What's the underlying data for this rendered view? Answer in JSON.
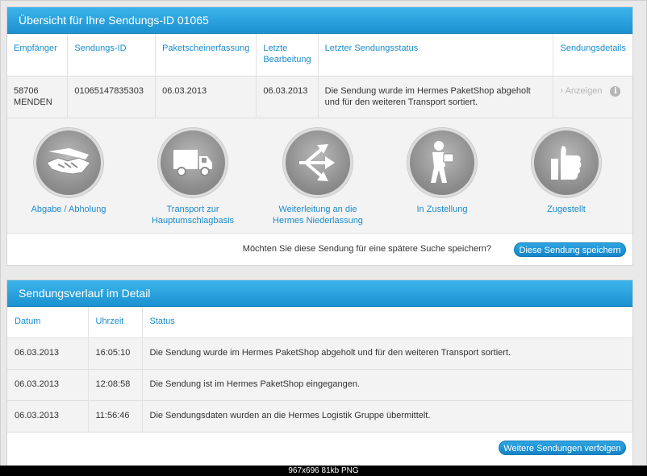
{
  "overview": {
    "title": "Übersicht für Ihre Sendungs-ID 01065",
    "headers": {
      "empfaenger": "Empfänger",
      "sendungs_id": "Sendungs-ID",
      "paketschein": "Paketscheinerfassung",
      "letzte_1": "Letzte",
      "letzte_2": "Bearbeitung",
      "status": "Letzter Sendungsstatus",
      "details": "Sendungsdetails"
    },
    "row": {
      "plz": "58706",
      "ort": "MENDEN",
      "sendungs_id": "01065147835303",
      "paketschein": "06.03.2013",
      "letzte": "06.03.2013",
      "status": "Die Sendung wurde im Hermes PaketShop abgeholt und für den weiteren Transport sortiert.",
      "anzeigen": "› Anzeigen",
      "info": "i"
    }
  },
  "steps": [
    {
      "line1": "Abgabe / Abholung",
      "line2": "",
      "icon": "handshake-icon"
    },
    {
      "line1": "Transport zur",
      "line2": "Hauptumschlagbasis",
      "icon": "truck-icon"
    },
    {
      "line1": "Weiterleitung an die",
      "line2": "Hermes Niederlassung",
      "icon": "arrows-icon"
    },
    {
      "line1": "In Zustellung",
      "line2": "",
      "icon": "courier-icon"
    },
    {
      "line1": "Zugestellt",
      "line2": "",
      "icon": "thumbs-up-icon"
    }
  ],
  "save": {
    "question": "Möchten Sie diese Sendung für eine spätere Suche speichern?",
    "button": "Diese Sendung speichern"
  },
  "detail": {
    "title": "Sendungsverlauf im Detail",
    "headers": {
      "datum": "Datum",
      "uhrzeit": "Uhrzeit",
      "status": "Status"
    },
    "rows": [
      {
        "datum": "06.03.2013",
        "uhrzeit": "16:05:10",
        "status": "Die Sendung wurde im Hermes PaketShop abgeholt und für den weiteren Transport sortiert."
      },
      {
        "datum": "06.03.2013",
        "uhrzeit": "12:08:58",
        "status": "Die Sendung ist im Hermes PaketShop eingegangen."
      },
      {
        "datum": "06.03.2013",
        "uhrzeit": "11:56:46",
        "status": "Die Sendungsdaten wurden an die Hermes Logistik Gruppe übermittelt."
      }
    ],
    "button": "Weitere Sendungen verfolgen"
  },
  "caption": "967x696 81kb PNG",
  "colors": {
    "accent": "#1b8ccc",
    "header_blue": "#2ea6e3",
    "icon_gray": "#8c8c8c"
  }
}
